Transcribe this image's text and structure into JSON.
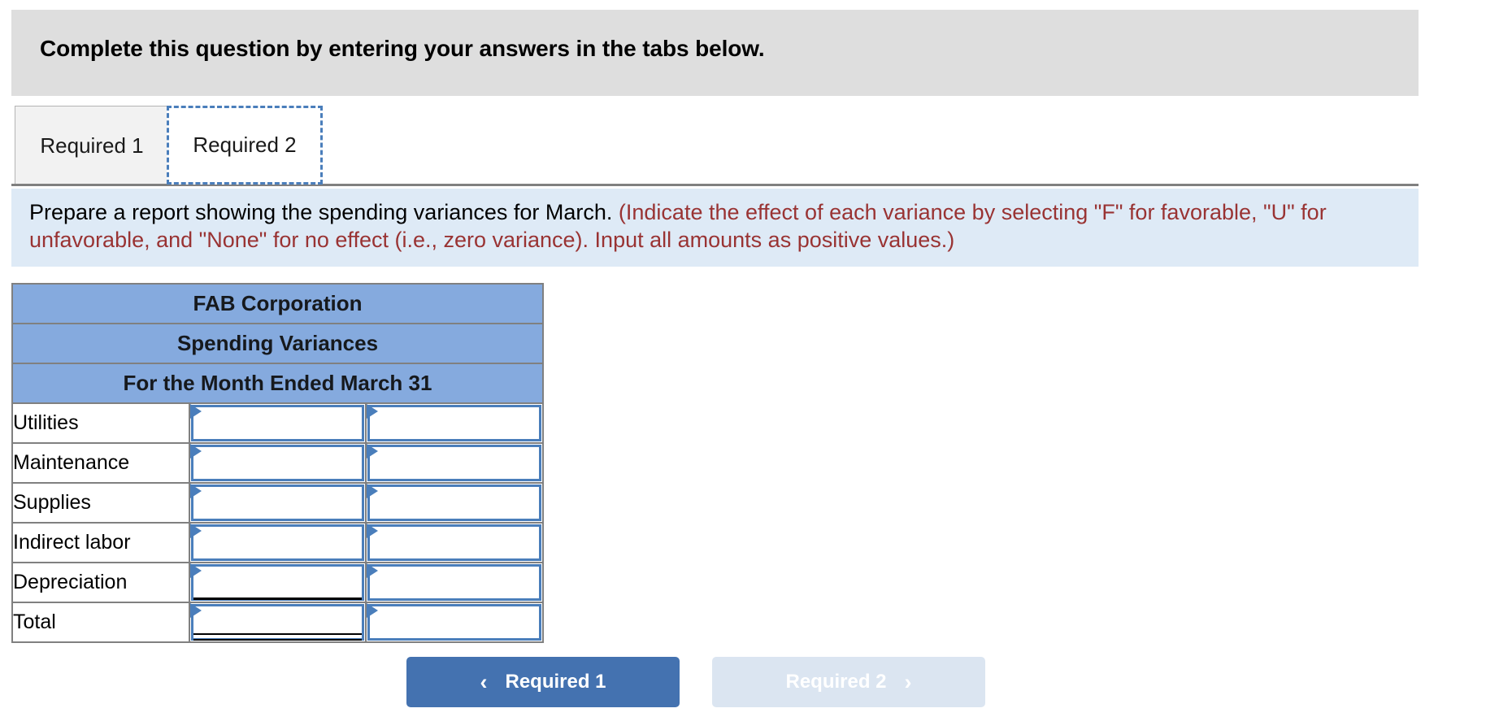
{
  "question_header": {
    "text": "Complete this question by entering your answers in the tabs below."
  },
  "tabs": [
    {
      "label": "Required 1",
      "active": false
    },
    {
      "label": "Required 2",
      "active": true
    }
  ],
  "requirement": {
    "prompt": "Prepare a report showing the spending variances for March.",
    "note_line1": "(Indicate the effect of each variance by selecting \"F\" for",
    "note_line2": "favorable, \"U\" for unfavorable, and \"None\" for no effect (i.e., zero variance). Input all amounts as positive values.)",
    "note_full": "(Indicate the effect of each variance by selecting \"F\" for favorable, \"U\" for unfavorable, and \"None\" for no effect (i.e., zero variance). Input all amounts as positive values.)"
  },
  "worksheet": {
    "title_lines": [
      "FAB Corporation",
      "Spending Variances",
      "For the Month Ended March 31"
    ],
    "rows": [
      {
        "label": "Utilities",
        "amount": "",
        "effect": ""
      },
      {
        "label": "Maintenance",
        "amount": "",
        "effect": ""
      },
      {
        "label": "Supplies",
        "amount": "",
        "effect": ""
      },
      {
        "label": "Indirect labor",
        "amount": "",
        "effect": ""
      },
      {
        "label": "Depreciation",
        "amount": "",
        "effect": ""
      },
      {
        "label": "Total",
        "amount": "",
        "effect": ""
      }
    ]
  },
  "navigation": {
    "prev_label": "Required 1",
    "prev_icon": "chevron-left-icon",
    "prev_glyph": "‹",
    "next_label": "Required 2",
    "next_icon": "chevron-right-icon",
    "next_glyph": "›"
  },
  "colors": {
    "header_bg": "#dedede",
    "banner_bg": "#deeaf6",
    "note_text": "#993333",
    "table_header_bg": "#85aade",
    "field_border": "#4a7ebb",
    "prev_button_bg": "#4472b0",
    "next_button_bg": "#dbe5f1"
  }
}
